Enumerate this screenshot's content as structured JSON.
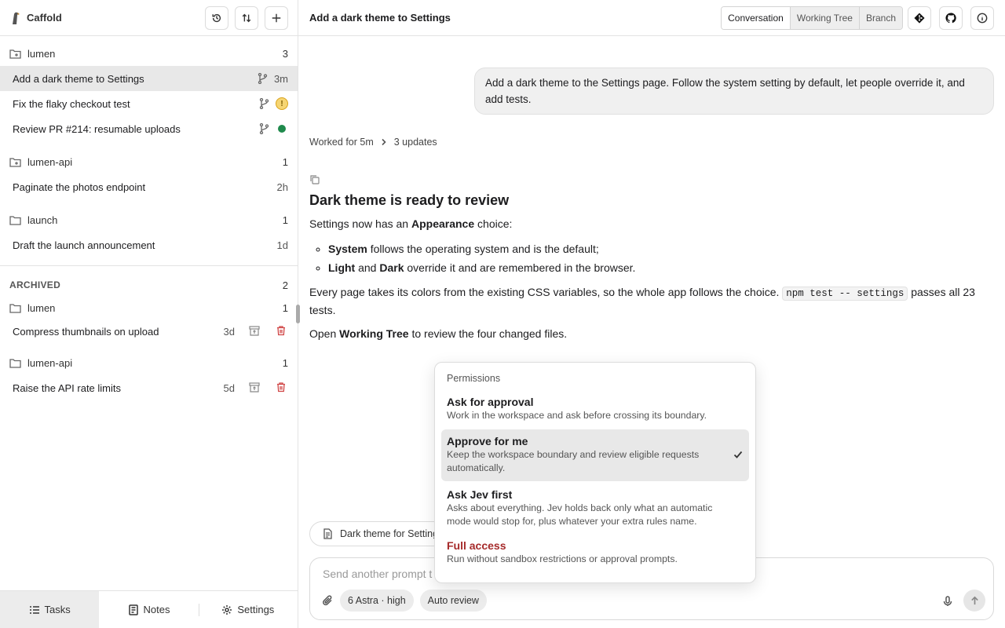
{
  "app": {
    "name": "Caffold"
  },
  "sidebar": {
    "groups": [
      {
        "name": "lumen",
        "count": "3",
        "tasks": [
          {
            "title": "Add a dark theme to Settings",
            "meta": "3m",
            "status": "active"
          },
          {
            "title": "Fix the flaky checkout test",
            "meta": "!",
            "status": "warning"
          },
          {
            "title": "Review PR #214: resumable uploads",
            "meta": "",
            "status": "success"
          }
        ]
      },
      {
        "name": "lumen-api",
        "count": "1",
        "tasks": [
          {
            "title": "Paginate the photos endpoint",
            "meta": "2h"
          }
        ]
      },
      {
        "name": "launch",
        "count": "1",
        "tasks": [
          {
            "title": "Draft the launch announcement",
            "meta": "1d"
          }
        ]
      }
    ],
    "archived": {
      "label": "ARCHIVED",
      "count": "2",
      "groups": [
        {
          "name": "lumen",
          "count": "1",
          "tasks": [
            {
              "title": "Compress thumbnails on upload",
              "meta": "3d"
            }
          ]
        },
        {
          "name": "lumen-api",
          "count": "1",
          "tasks": [
            {
              "title": "Raise the API rate limits",
              "meta": "5d"
            }
          ]
        }
      ]
    },
    "bottom_tabs": [
      {
        "label": "Tasks",
        "icon": "list-icon"
      },
      {
        "label": "Notes",
        "icon": "notes-icon"
      },
      {
        "label": "Settings",
        "icon": "gear-icon"
      }
    ]
  },
  "header": {
    "title": "Add a dark theme to Settings",
    "views": [
      "Conversation",
      "Working Tree",
      "Branch"
    ]
  },
  "conversation": {
    "user_message": "Add a dark theme to the Settings page. Follow the system setting by default, let people override it, and add tests.",
    "worked_label": "Worked for 5m",
    "updates_label": "3 updates",
    "answer": {
      "heading": "Dark theme is ready to review",
      "p1_a": "Settings now has an ",
      "p1_b": "Appearance",
      "p1_c": " choice:",
      "li1_a": "System",
      "li1_b": " follows the operating system and is the default;",
      "li2_a": "Light",
      "li2_b": " and ",
      "li2_c": "Dark",
      "li2_d": " override it and are remembered in the browser.",
      "p2_a": "Every page takes its colors from the existing CSS variables, so the whole app follows the choice. ",
      "p2_code": "npm test -- settings",
      "p2_b": " passes all 23 tests.",
      "p3_a": "Open ",
      "p3_b": "Working Tree",
      "p3_c": " to review the four changed files."
    }
  },
  "attachment": {
    "label": "Dark theme for Settings"
  },
  "composer": {
    "placeholder": "Send another prompt t",
    "model_pill": "6 Astra  · high",
    "review_pill": "Auto review"
  },
  "permissions_menu": {
    "title": "Permissions",
    "options": [
      {
        "name": "Ask for approval",
        "desc": "Work in the workspace and ask before crossing its boundary."
      },
      {
        "name": "Approve for me",
        "desc": "Keep the workspace boundary and review eligible requests automatically.",
        "selected": true
      },
      {
        "name": "Ask Jev first",
        "desc": "Asks about everything. Jev holds back only what an automatic mode would stop for, plus whatever your extra rules name."
      },
      {
        "name": "Full access",
        "desc": "Run without sandbox restrictions or approval prompts.",
        "danger": true
      }
    ]
  },
  "colors": {
    "danger": "#a62b2b",
    "success": "#1f8a4c",
    "warning": "#f6d572",
    "active_row": "#e8e8e8"
  }
}
